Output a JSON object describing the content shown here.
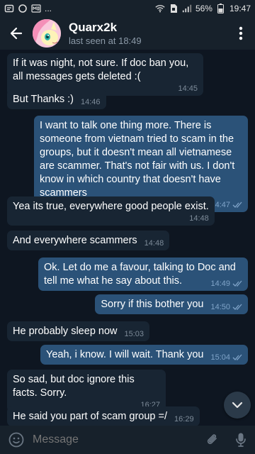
{
  "statusbar": {
    "battery": "56%",
    "time": "19:47"
  },
  "header": {
    "title": "Quarx2k",
    "status": "last seen at 18:49"
  },
  "messages": [
    {
      "dir": "in",
      "text": "If it was night, not sure. If doc ban you,  all messages gets deleted :(",
      "time": "14:45"
    },
    {
      "dir": "in",
      "text": "But Thanks :)",
      "time": "14:46"
    },
    {
      "dir": "out",
      "text": "I want to talk one thing more. There is someone from vietnam tried to scam in the groups, but it doesn't mean all vietnamese are scammer. That's not fair with us. I don't know in which country that doesn't have scammers",
      "time": "14:47"
    },
    {
      "dir": "in",
      "text": "Yea its true, everywhere good people exist.",
      "time": "14:48"
    },
    {
      "dir": "in",
      "text": "And everywhere scammers",
      "time": "14:48"
    },
    {
      "dir": "out",
      "text": "Ok. Let do me a favour, talking to Doc and tell me what he say about this.",
      "time": "14:49"
    },
    {
      "dir": "out",
      "text": "Sorry if this bother you",
      "time": "14:50"
    },
    {
      "dir": "in",
      "text": "He probably sleep now",
      "time": "15:03"
    },
    {
      "dir": "out",
      "text": "Yeah, i know. I will wait. Thank you",
      "time": "15:04"
    },
    {
      "dir": "in",
      "text": "So sad, but doc ignore this facts. Sorry.",
      "time": "16:27"
    },
    {
      "dir": "in",
      "text": "He said you part of scam group =/",
      "time": "16:29"
    }
  ],
  "input": {
    "placeholder": "Message"
  },
  "colors": {
    "background": "#0e1621",
    "bar": "#17212b",
    "incoming": "#182533",
    "outgoing": "#2b5278",
    "accent": "#6ab2f2"
  }
}
